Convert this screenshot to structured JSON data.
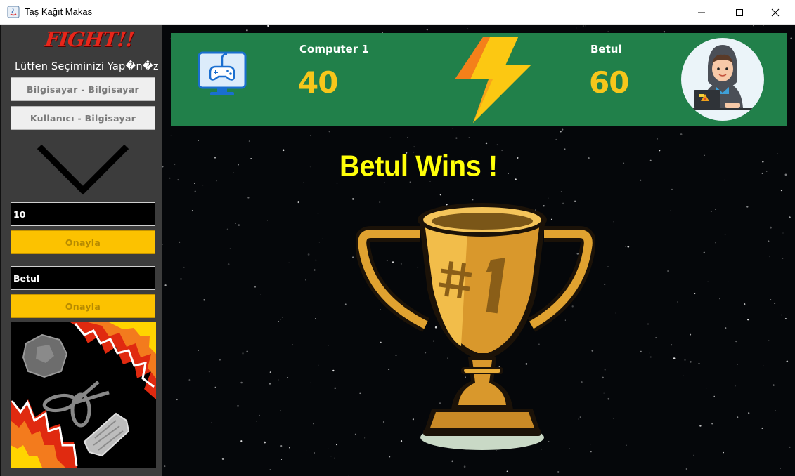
{
  "window": {
    "title": "Taş Kağıt Makas",
    "minimize_icon": "minimize-icon",
    "maximize_icon": "maximize-icon",
    "close_icon": "close-icon"
  },
  "sidebar": {
    "banner": "FIGHT!!",
    "prompt": "Lütfen Seçiminizi Yap�n�z",
    "mode_buttons": [
      {
        "label": "Bilgisayar - Bilgisayar"
      },
      {
        "label": "Kullanıcı - Bilgisayar"
      }
    ],
    "rounds_value": "10",
    "confirm_label_1": "Onayla",
    "name_value": "Betul",
    "confirm_label_2": "Onayla",
    "decor_icon": "chevron-down-icon",
    "image": "rock-scissors-paper-image"
  },
  "scoreboard": {
    "left_name": "Computer 1",
    "left_score": "40",
    "right_name": "Betul",
    "right_score": "60",
    "left_icon": "computer-gamepad-icon",
    "center_icon": "lightning-bolt-icon",
    "right_icon": "user-avatar-icon"
  },
  "result": {
    "text": "Betul Wins !",
    "trophy_icon": "trophy-icon"
  },
  "colors": {
    "scoreboard_bg": "#21804a",
    "score_yellow": "#f6c61b",
    "winner_yellow": "#ffff0a",
    "confirm_bg": "#fcc200",
    "fight_red": "#e8261a"
  }
}
